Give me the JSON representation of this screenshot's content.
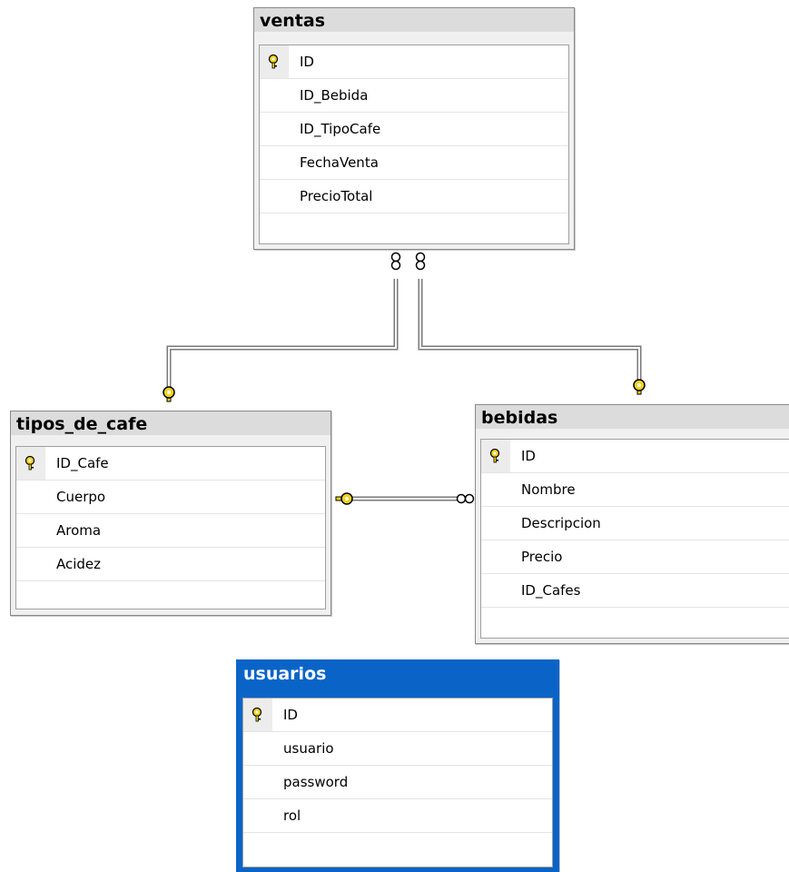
{
  "tables": {
    "ventas": {
      "name": "ventas",
      "columns": [
        "ID",
        "ID_Bebida",
        "ID_TipoCafe",
        "FechaVenta",
        "PrecioTotal"
      ]
    },
    "tipos_de_cafe": {
      "name": "tipos_de_cafe",
      "columns": [
        "ID_Cafe",
        "Cuerpo",
        "Aroma",
        "Acidez"
      ]
    },
    "bebidas": {
      "name": "bebidas",
      "columns": [
        "ID",
        "Nombre",
        "Descripcion",
        "Precio",
        "ID_Cafes"
      ]
    },
    "usuarios": {
      "name": "usuarios",
      "columns": [
        "ID",
        "usuario",
        "password",
        "rol"
      ]
    }
  },
  "relationships": [
    {
      "from": "ventas",
      "to": "tipos_de_cafe"
    },
    {
      "from": "ventas",
      "to": "bebidas"
    },
    {
      "from": "bebidas",
      "to": "tipos_de_cafe"
    }
  ],
  "colors": {
    "key": "#f2d21c",
    "selected_table": "#0a64c8"
  }
}
